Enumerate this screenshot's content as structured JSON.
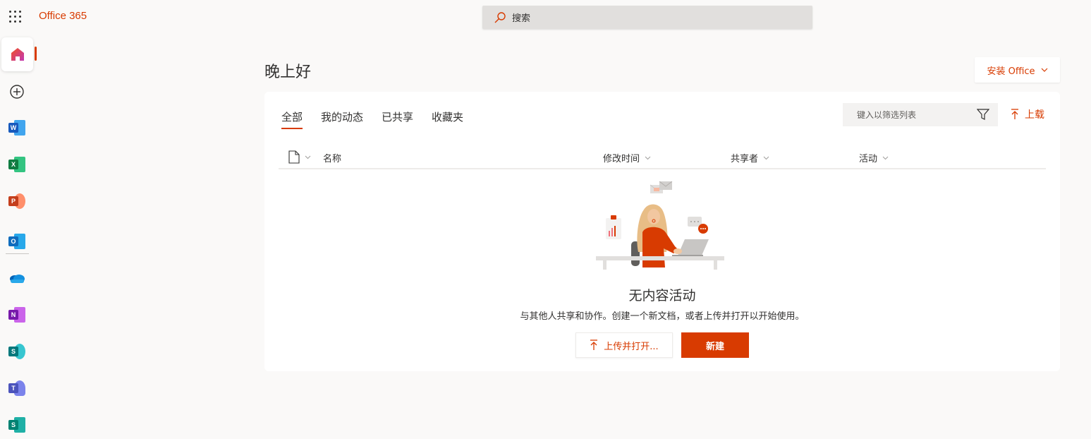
{
  "header": {
    "brand": "Office 365",
    "search_placeholder": "搜索"
  },
  "rail": {
    "apps": [
      {
        "name": "home",
        "letter": ""
      },
      {
        "name": "create",
        "letter": ""
      },
      {
        "name": "word",
        "letter": "W",
        "color": "#185abd"
      },
      {
        "name": "excel",
        "letter": "X",
        "color": "#107c41"
      },
      {
        "name": "powerpoint",
        "letter": "P",
        "color": "#c43e1c"
      },
      {
        "name": "outlook",
        "letter": "O",
        "color": "#0f6cbd"
      },
      {
        "name": "onedrive",
        "letter": ""
      },
      {
        "name": "onenote",
        "letter": "N",
        "color": "#7719aa"
      },
      {
        "name": "sharepoint",
        "letter": "S",
        "color": "#03787c"
      },
      {
        "name": "teams",
        "letter": "T",
        "color": "#4b53bc"
      },
      {
        "name": "sway",
        "letter": "S",
        "color": "#008272"
      }
    ]
  },
  "main": {
    "greeting": "晚上好",
    "install_label": "安装 Office",
    "tabs": [
      "全部",
      "我的动态",
      "已共享",
      "收藏夹"
    ],
    "filter_placeholder": "键入以筛选列表",
    "upload_label": "上载",
    "columns": {
      "name": "名称",
      "modified": "修改时间",
      "shared_by": "共享者",
      "activity": "活动"
    },
    "empty": {
      "title": "无内容活动",
      "subtitle": "与其他人共享和协作。创建一个新文档，或者上传并打开以开始使用。",
      "upload_open_label": "上传并打开...",
      "new_label": "新建"
    }
  },
  "colors": {
    "accent": "#d83b01",
    "background": "#faf9f8"
  }
}
